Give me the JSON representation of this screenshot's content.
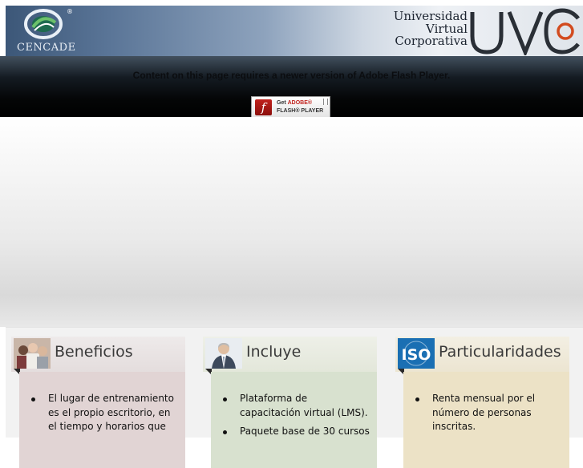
{
  "header": {
    "cencade_logo_text": "CENCADE",
    "registered_mark": "®",
    "uvc_name_lines": [
      "Universidad",
      "Virtual",
      "Corporativa"
    ],
    "uvc_logo_text": "UVC"
  },
  "flash": {
    "message": "Content on this page requires a newer version of Adobe Flash Player.",
    "button_get": "Get ",
    "button_adobe": "ADOBE®",
    "button_product": "FLASH® PLAYER",
    "button_icon_glyph": "f"
  },
  "cards": [
    {
      "title": "Beneficios",
      "icon": "people-photo",
      "items": [
        "El lugar de entrenamiento es el propio escritorio, en el tiempo y horarios que"
      ]
    },
    {
      "title": "Incluye",
      "icon": "businessman-photo",
      "items": [
        "Plataforma de capacitación virtual (LMS).",
        "Paquete base de 30 cursos"
      ]
    },
    {
      "title": "Particularidades",
      "icon": "iso-badge",
      "icon_text": "ISO",
      "items": [
        "Renta mensual por el número de personas inscritas."
      ]
    }
  ],
  "colors": {
    "banner_dark": "#3c5778",
    "flash_red": "#c0221d",
    "card1_body": "#e1d4d4",
    "card2_body": "#d8e1cf",
    "card3_body": "#ece2c6"
  }
}
